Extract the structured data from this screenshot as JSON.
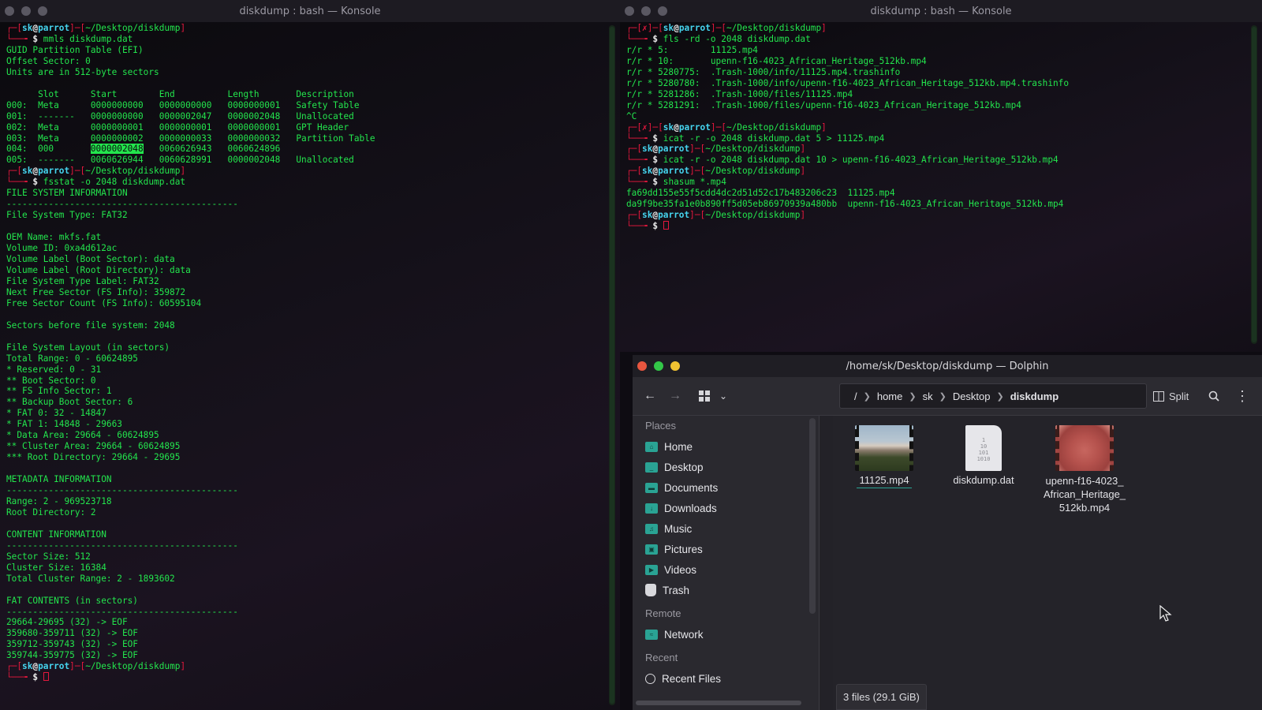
{
  "left_terminal": {
    "title": "diskdump : bash — Konsole",
    "prompt1": {
      "user": "sk",
      "host": "parrot",
      "path": "~/Desktop/diskdump",
      "command": "mmls diskdump.dat"
    },
    "mmls_header": [
      "GUID Partition Table (EFI)",
      "Offset Sector: 0",
      "Units are in 512-byte sectors"
    ],
    "mmls_columns": "      Slot      Start        End          Length       Description",
    "mmls_rows": [
      "000:  Meta      0000000000   0000000000   0000000001   Safety Table",
      "001:  -------   0000000000   0000002047   0000002048   Unallocated",
      "002:  Meta      0000000001   0000000001   0000000001   GPT Header",
      "003:  Meta      0000000002   0000000033   0000000032   Partition Table"
    ],
    "mmls_row4_pre": "004:  000       ",
    "mmls_row4_hl": "0000002048",
    "mmls_row4_post": "   0060626943   0060624896",
    "mmls_row5": "005:  -------   0060626944   0060628991   0000002048   Unallocated",
    "prompt2": {
      "user": "sk",
      "host": "parrot",
      "path": "~/Desktop/diskdump",
      "command": "fsstat -o 2048 diskdump.dat"
    },
    "fsstat_lines": [
      "FILE SYSTEM INFORMATION",
      "--------------------------------------------",
      "File System Type: FAT32",
      "",
      "OEM Name: mkfs.fat",
      "Volume ID: 0xa4d612ac",
      "Volume Label (Boot Sector): data",
      "Volume Label (Root Directory): data",
      "File System Type Label: FAT32",
      "Next Free Sector (FS Info): 359872",
      "Free Sector Count (FS Info): 60595104",
      "",
      "Sectors before file system: 2048",
      "",
      "File System Layout (in sectors)",
      "Total Range: 0 - 60624895",
      "* Reserved: 0 - 31",
      "** Boot Sector: 0",
      "** FS Info Sector: 1",
      "** Backup Boot Sector: 6",
      "* FAT 0: 32 - 14847",
      "* FAT 1: 14848 - 29663",
      "* Data Area: 29664 - 60624895",
      "** Cluster Area: 29664 - 60624895",
      "*** Root Directory: 29664 - 29695",
      "",
      "METADATA INFORMATION",
      "--------------------------------------------",
      "Range: 2 - 969523718",
      "Root Directory: 2",
      "",
      "CONTENT INFORMATION",
      "--------------------------------------------",
      "Sector Size: 512",
      "Cluster Size: 16384",
      "Total Cluster Range: 2 - 1893602",
      "",
      "FAT CONTENTS (in sectors)",
      "--------------------------------------------",
      "29664-29695 (32) -> EOF",
      "359680-359711 (32) -> EOF",
      "359712-359743 (32) -> EOF",
      "359744-359775 (32) -> EOF"
    ],
    "prompt3": {
      "user": "sk",
      "host": "parrot",
      "path": "~/Desktop/diskdump"
    }
  },
  "right_terminal": {
    "title": "diskdump : bash — Konsole",
    "prompt1": {
      "user": "sk",
      "host": "parrot",
      "path": "~/Desktop/diskdump",
      "command": "fls -rd -o 2048 diskdump.dat"
    },
    "fls_lines": [
      "r/r * 5:        11125.mp4",
      "r/r * 10:       upenn-f16-4023_African_Heritage_512kb.mp4",
      "r/r * 5280775:  .Trash-1000/info/11125.mp4.trashinfo",
      "r/r * 5280780:  .Trash-1000/info/upenn-f16-4023_African_Heritage_512kb.mp4.trashinfo",
      "r/r * 5281286:  .Trash-1000/files/11125.mp4",
      "r/r * 5281291:  .Trash-1000/files/upenn-f16-4023_African_Heritage_512kb.mp4",
      "^C"
    ],
    "prompt2": {
      "user": "sk",
      "host": "parrot",
      "path": "~/Desktop/diskdump",
      "command": "icat -r -o 2048 diskdump.dat 5 > 11125.mp4"
    },
    "prompt3": {
      "user": "sk",
      "host": "parrot",
      "path": "~/Desktop/diskdump",
      "command": "icat -r -o 2048 diskdump.dat 10 > upenn-f16-4023_African_Heritage_512kb.mp4"
    },
    "prompt4": {
      "user": "sk",
      "host": "parrot",
      "path": "~/Desktop/diskdump",
      "command": "shasum *.mp4"
    },
    "shasum_lines": [
      "fa69dd155e55f5cdd4dc2d51d52c17b483206c23  11125.mp4",
      "da9f9be35fa1e0b890ff5d05eb86970939a480bb  upenn-f16-4023_African_Heritage_512kb.mp4"
    ],
    "prompt5": {
      "user": "sk",
      "host": "parrot",
      "path": "~/Desktop/diskdump"
    }
  },
  "dolphin": {
    "title": "/home/sk/Desktop/diskdump — Dolphin",
    "breadcrumb": [
      "/",
      "home",
      "sk",
      "Desktop",
      "diskdump"
    ],
    "split_label": "Split",
    "places_heading": "Places",
    "places": [
      "Home",
      "Desktop",
      "Documents",
      "Downloads",
      "Music",
      "Pictures",
      "Videos",
      "Trash"
    ],
    "remote_heading": "Remote",
    "remote": [
      "Network"
    ],
    "recent_heading": "Recent",
    "recent": [
      "Recent Files"
    ],
    "files": [
      {
        "name": "11125.mp4"
      },
      {
        "name": "diskdump.dat"
      },
      {
        "name": "upenn-f16-4023_\nAfrican_Heritage_\n512kb.mp4"
      }
    ],
    "status": "3 files (29.1 GiB)"
  },
  "colors": {
    "green": "#23e54d",
    "red": "#e4183d",
    "cyan": "#45d4ee",
    "accent": "#2aa394"
  }
}
